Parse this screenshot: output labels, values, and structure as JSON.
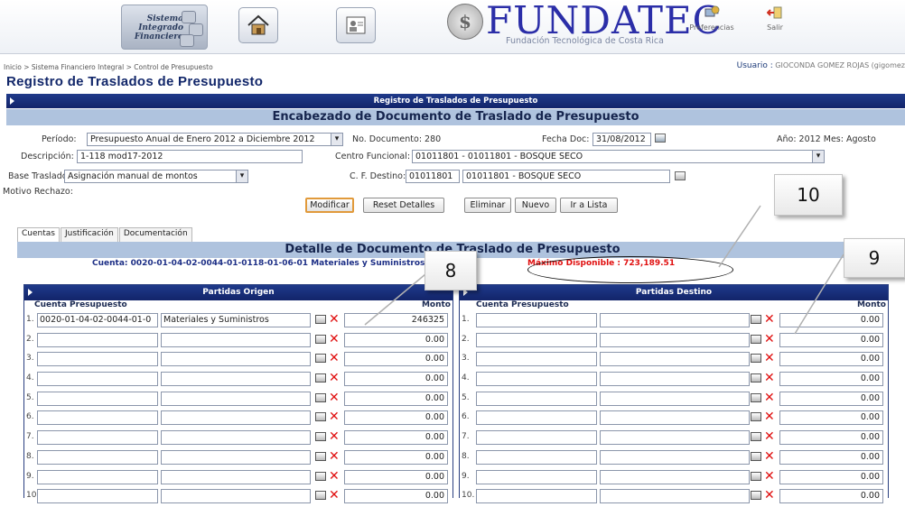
{
  "header": {
    "system_logo_lines": [
      "Sistema",
      "Integrado",
      "Financiero"
    ],
    "home_icon": "home-icon",
    "profile_icon": "id-card-icon",
    "brand_name": "FUNDATEC",
    "brand_subtitle": "Fundación Tecnológica de Costa Rica",
    "preferences_label": "Preferencias",
    "exit_label": "Salir"
  },
  "breadcrumb": "Inicio > Sistema Financiero Integral > Control de Presupuesto",
  "user": {
    "label": "Usuario :",
    "name": "GIOCONDA GOMEZ ROJAS (gigomez"
  },
  "page_title": "Registro de Traslados de Presupuesto",
  "title_bar": "Registro de Traslados de Presupuesto",
  "section_header": "Encabezado de Documento de Traslado de Presupuesto",
  "form": {
    "periodo_label": "Período:",
    "periodo_value": "Presupuesto Anual de Enero 2012 a Diciembre 2012",
    "no_documento": "No. Documento: 280",
    "fecha_doc_label": "Fecha Doc:",
    "fecha_doc_value": "31/08/2012",
    "anio_mes": "Año: 2012 Mes: Agosto",
    "descripcion_label": "Descripción:",
    "descripcion_value": "1-118 mod17-2012",
    "centro_label": "Centro Funcional:",
    "centro_value": "01011801 - 01011801 - BOSQUE SECO",
    "base_label": "Base Traslado:",
    "base_value": "Asignación manual de montos",
    "cf_destino_label": "C. F. Destino:",
    "cf_destino_code": "01011801",
    "cf_destino_name": "01011801 - BOSQUE SECO",
    "motivo_label": "Motivo Rechazo:"
  },
  "buttons": {
    "modificar": "Modificar",
    "reset": "Reset Detalles",
    "eliminar": "Eliminar",
    "nuevo": "Nuevo",
    "ir_lista": "Ir a Lista"
  },
  "tabs": [
    "Cuentas",
    "Justificación",
    "Documentación"
  ],
  "detail": {
    "bar_title": "Detalle de Documento de Traslado de Presupuesto",
    "cuenta_line": "Cuenta: 0020-01-04-02-0044-01-0118-01-06-01 Materiales y Suministros",
    "maximo": "Máximo Disponible : 723,189.51"
  },
  "origen": {
    "title": "Partidas Origen",
    "col_cuenta": "Cuenta Presupuesto",
    "col_monto": "Monto",
    "rows": [
      {
        "n": "1.",
        "cuenta": "0020-01-04-02-0044-01-0",
        "desc": "Materiales y Suministros",
        "monto": "246325"
      },
      {
        "n": "2.",
        "cuenta": "",
        "desc": "",
        "monto": "0.00"
      },
      {
        "n": "3.",
        "cuenta": "",
        "desc": "",
        "monto": "0.00"
      },
      {
        "n": "4.",
        "cuenta": "",
        "desc": "",
        "monto": "0.00"
      },
      {
        "n": "5.",
        "cuenta": "",
        "desc": "",
        "monto": "0.00"
      },
      {
        "n": "6.",
        "cuenta": "",
        "desc": "",
        "monto": "0.00"
      },
      {
        "n": "7.",
        "cuenta": "",
        "desc": "",
        "monto": "0.00"
      },
      {
        "n": "8.",
        "cuenta": "",
        "desc": "",
        "monto": "0.00"
      },
      {
        "n": "9.",
        "cuenta": "",
        "desc": "",
        "monto": "0.00"
      },
      {
        "n": "10.",
        "cuenta": "",
        "desc": "",
        "monto": "0.00"
      }
    ]
  },
  "destino": {
    "title": "Partidas Destino",
    "col_cuenta": "Cuenta Presupuesto",
    "col_monto": "Monto",
    "rows": [
      {
        "n": "1.",
        "cuenta": "",
        "desc": "",
        "monto": "0.00"
      },
      {
        "n": "2.",
        "cuenta": "",
        "desc": "",
        "monto": "0.00"
      },
      {
        "n": "3.",
        "cuenta": "",
        "desc": "",
        "monto": "0.00"
      },
      {
        "n": "4.",
        "cuenta": "",
        "desc": "",
        "monto": "0.00"
      },
      {
        "n": "5.",
        "cuenta": "",
        "desc": "",
        "monto": "0.00"
      },
      {
        "n": "6.",
        "cuenta": "",
        "desc": "",
        "monto": "0.00"
      },
      {
        "n": "7.",
        "cuenta": "",
        "desc": "",
        "monto": "0.00"
      },
      {
        "n": "8.",
        "cuenta": "",
        "desc": "",
        "monto": "0.00"
      },
      {
        "n": "9.",
        "cuenta": "",
        "desc": "",
        "monto": "0.00"
      },
      {
        "n": "10.",
        "cuenta": "",
        "desc": "",
        "monto": "0.00"
      }
    ]
  },
  "callouts": {
    "c10": "10",
    "c8": "8",
    "c9": "9"
  },
  "colors": {
    "navy": "#12246a",
    "section_blue": "#afc3de",
    "brand": "#2b2ea8",
    "alert_red": "#e01010"
  }
}
